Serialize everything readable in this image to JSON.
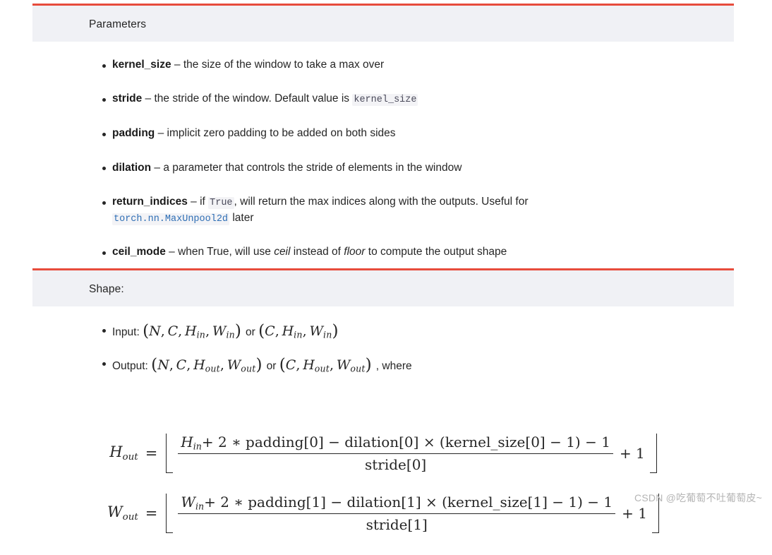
{
  "colors": {
    "accent_bar": "#e74c3c",
    "header_bg": "#f0f1f5",
    "body_text": "#262626",
    "code_text": "#4a4a5a",
    "code_bg": "#f3f3f6",
    "link": "#2f6fb5",
    "watermark": "#b5b5b5"
  },
  "sections": {
    "parameters": {
      "title": "Parameters",
      "items": [
        {
          "name": "kernel_size",
          "dash": "–",
          "desc_before": "the size of the window to take a max over",
          "code": null,
          "desc_after": ""
        },
        {
          "name": "stride",
          "dash": "–",
          "desc_before": "the stride of the window. Default value is",
          "code": "kernel_size",
          "desc_after": ""
        },
        {
          "name": "padding",
          "dash": "–",
          "desc_before": "implicit zero padding to be added on both sides",
          "code": null,
          "desc_after": ""
        },
        {
          "name": "dilation",
          "dash": "–",
          "desc_before": "a parameter that controls the stride of elements in the window",
          "code": null,
          "desc_after": ""
        },
        {
          "name": "return_indices",
          "dash": "–",
          "desc_before": "if",
          "code": "True",
          "desc_after": ", will return the max indices along with the outputs. Useful for",
          "link_code": "torch.nn.MaxUnpool2d",
          "desc_tail": "later"
        },
        {
          "name": "ceil_mode",
          "dash": "–",
          "desc_before": "when True, will use",
          "italic_1": "ceil",
          "desc_mid": "instead of",
          "italic_2": "floor",
          "desc_after": "to compute the output shape"
        }
      ]
    },
    "shape": {
      "title": "Shape:",
      "items": [
        {
          "label": "Input:",
          "expr_1": "(N, C, H_in, W_in)",
          "conj": "or",
          "expr_2": "(C, H_in, W_in)",
          "trailing": ""
        },
        {
          "label": "Output:",
          "expr_1": "(N, C, H_out, W_out)",
          "conj": "or",
          "expr_2": "(C, H_out, W_out)",
          "trailing": ", where"
        }
      ],
      "formulas": [
        {
          "lhs_base": "H",
          "lhs_sub": "out",
          "equals": "=",
          "numerator": "H_in + 2 * padding[0] − dilation[0] × (kernel_size[0] − 1) − 1",
          "num_var": "H",
          "num_var_sub": "in",
          "num_rest": "+ 2 ∗ padding[0] − dilation[0] × (kernel_size[0] − 1) − 1",
          "denominator": "stride[0]",
          "tail": "+ 1"
        },
        {
          "lhs_base": "W",
          "lhs_sub": "out",
          "equals": "=",
          "numerator": "W_in + 2 * padding[1] − dilation[1] × (kernel_size[1] − 1) − 1",
          "num_var": "W",
          "num_var_sub": "in",
          "num_rest": "+ 2 ∗ padding[1] − dilation[1] × (kernel_size[1] − 1) − 1",
          "denominator": "stride[1]",
          "tail": "+ 1"
        }
      ]
    }
  },
  "watermark": "CSDN @吃葡萄不吐葡萄皮~"
}
